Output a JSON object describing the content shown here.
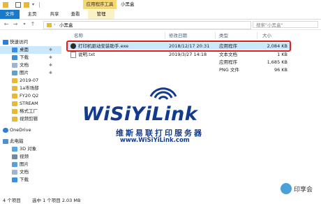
{
  "titlebar": {
    "ctx_tab_title": "应用程序工具",
    "window_title": "小黑盒"
  },
  "ribbon": {
    "tabs": [
      "文件",
      "主页",
      "共享",
      "查看",
      "管理"
    ]
  },
  "address": {
    "path": "小黑盒",
    "search_placeholder": "搜索\"小黑盒\""
  },
  "sidebar": {
    "items": [
      {
        "label": "快速访问",
        "icon": "star-icon",
        "pinned": false
      },
      {
        "label": "桌面",
        "icon": "desktop-icon",
        "pinned": true
      },
      {
        "label": "下载",
        "icon": "download-icon",
        "pinned": true
      },
      {
        "label": "文档",
        "icon": "document-icon",
        "pinned": true
      },
      {
        "label": "图片",
        "icon": "picture-icon",
        "pinned": true
      },
      {
        "label": "2019-07",
        "icon": "folder-icon",
        "pinned": false
      },
      {
        "label": "1a市场部",
        "icon": "folder-icon",
        "pinned": false
      },
      {
        "label": "FY20 Q2",
        "icon": "folder-icon",
        "pinned": false
      },
      {
        "label": "STREAM",
        "icon": "folder-icon",
        "pinned": false
      },
      {
        "label": "格式工厂",
        "icon": "folder-icon",
        "pinned": false
      },
      {
        "label": "视频剪辑",
        "icon": "folder-icon",
        "pinned": false
      },
      {
        "label": "OneDrive",
        "icon": "cloud-icon",
        "pinned": false
      },
      {
        "label": "此电脑",
        "icon": "computer-icon",
        "pinned": false
      },
      {
        "label": "3D 对象",
        "icon": "cube-icon",
        "pinned": false
      },
      {
        "label": "视频",
        "icon": "video-icon",
        "pinned": false
      },
      {
        "label": "图片",
        "icon": "picture-icon",
        "pinned": false
      },
      {
        "label": "文档",
        "icon": "document-icon",
        "pinned": false
      },
      {
        "label": "下载",
        "icon": "download-icon",
        "pinned": false
      }
    ]
  },
  "columns": {
    "name": "名称",
    "date": "修改日期",
    "type": "类型",
    "size": "大小"
  },
  "files": [
    {
      "name": "打印机驱动安装助手.exe",
      "date": "2018/12/17 20:31",
      "type": "应用程序",
      "size": "2,084 KB"
    },
    {
      "name": "说明.txt",
      "date": "2019/3/27 14:18",
      "type": "文本文档",
      "size": "1 KB"
    },
    {
      "name": "",
      "date": "",
      "type": "应用程序",
      "size": "1,685 KB"
    },
    {
      "name": "",
      "date": "",
      "type": "PNG 文件",
      "size": "96 KB"
    }
  ],
  "logo": {
    "brand": "WiSiYiLink",
    "chinese": "维斯易联打印服务器",
    "url": "www.WiSiYiLink.com"
  },
  "status": {
    "count": "4 个项目",
    "selected": "选中 1 个项目 2.03 MB"
  },
  "watermark": {
    "text": "印享会"
  },
  "colors": {
    "accent": "#1979ca",
    "selection": "#cce8ff",
    "highlight": "#e51c1c",
    "logo": "#123a8e"
  }
}
